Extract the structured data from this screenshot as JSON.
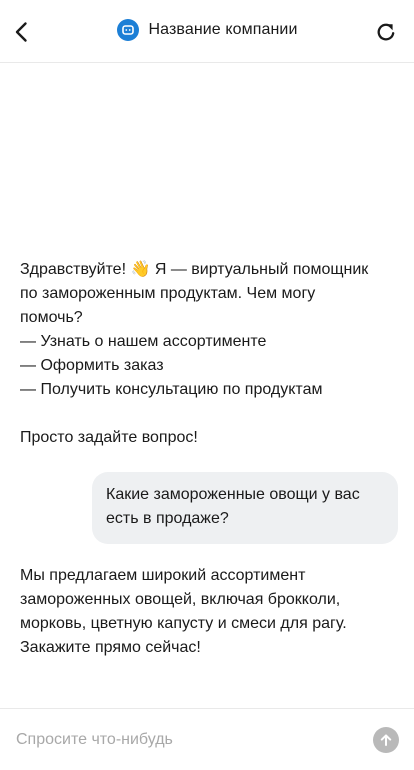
{
  "header": {
    "title": "Название компании",
    "back_icon": "chevron-left-icon",
    "refresh_icon": "refresh-icon",
    "logo_icon": "chat-bot-logo-icon",
    "logo_color": "#1c7fd6"
  },
  "messages": [
    {
      "role": "bot",
      "lines": [
        "Здравствуйте! 👋 Я — виртуальный помощник",
        "по замороженным продуктам. Чем могу",
        "помочь?",
        "— Узнать о нашем ассортименте",
        "— Оформить заказ",
        "— Получить консультацию по продуктам",
        "",
        "Просто задайте вопрос!"
      ]
    },
    {
      "role": "user",
      "lines": [
        "Какие замороженные овощи у вас",
        "есть в продаже?"
      ]
    },
    {
      "role": "bot",
      "lines": [
        "Мы предлагаем широкий ассортимент",
        "замороженных овощей, включая брокколи,",
        "морковь, цветную капусту и смеси для рагу.",
        "Закажите прямо сейчас!"
      ]
    }
  ],
  "composer": {
    "placeholder": "Спросите что-нибудь",
    "value": "",
    "send_icon": "arrow-up-icon",
    "send_color": "#b9b9b9"
  },
  "colors": {
    "user_bubble": "#eef0f2",
    "divider": "#e9e9e9"
  }
}
